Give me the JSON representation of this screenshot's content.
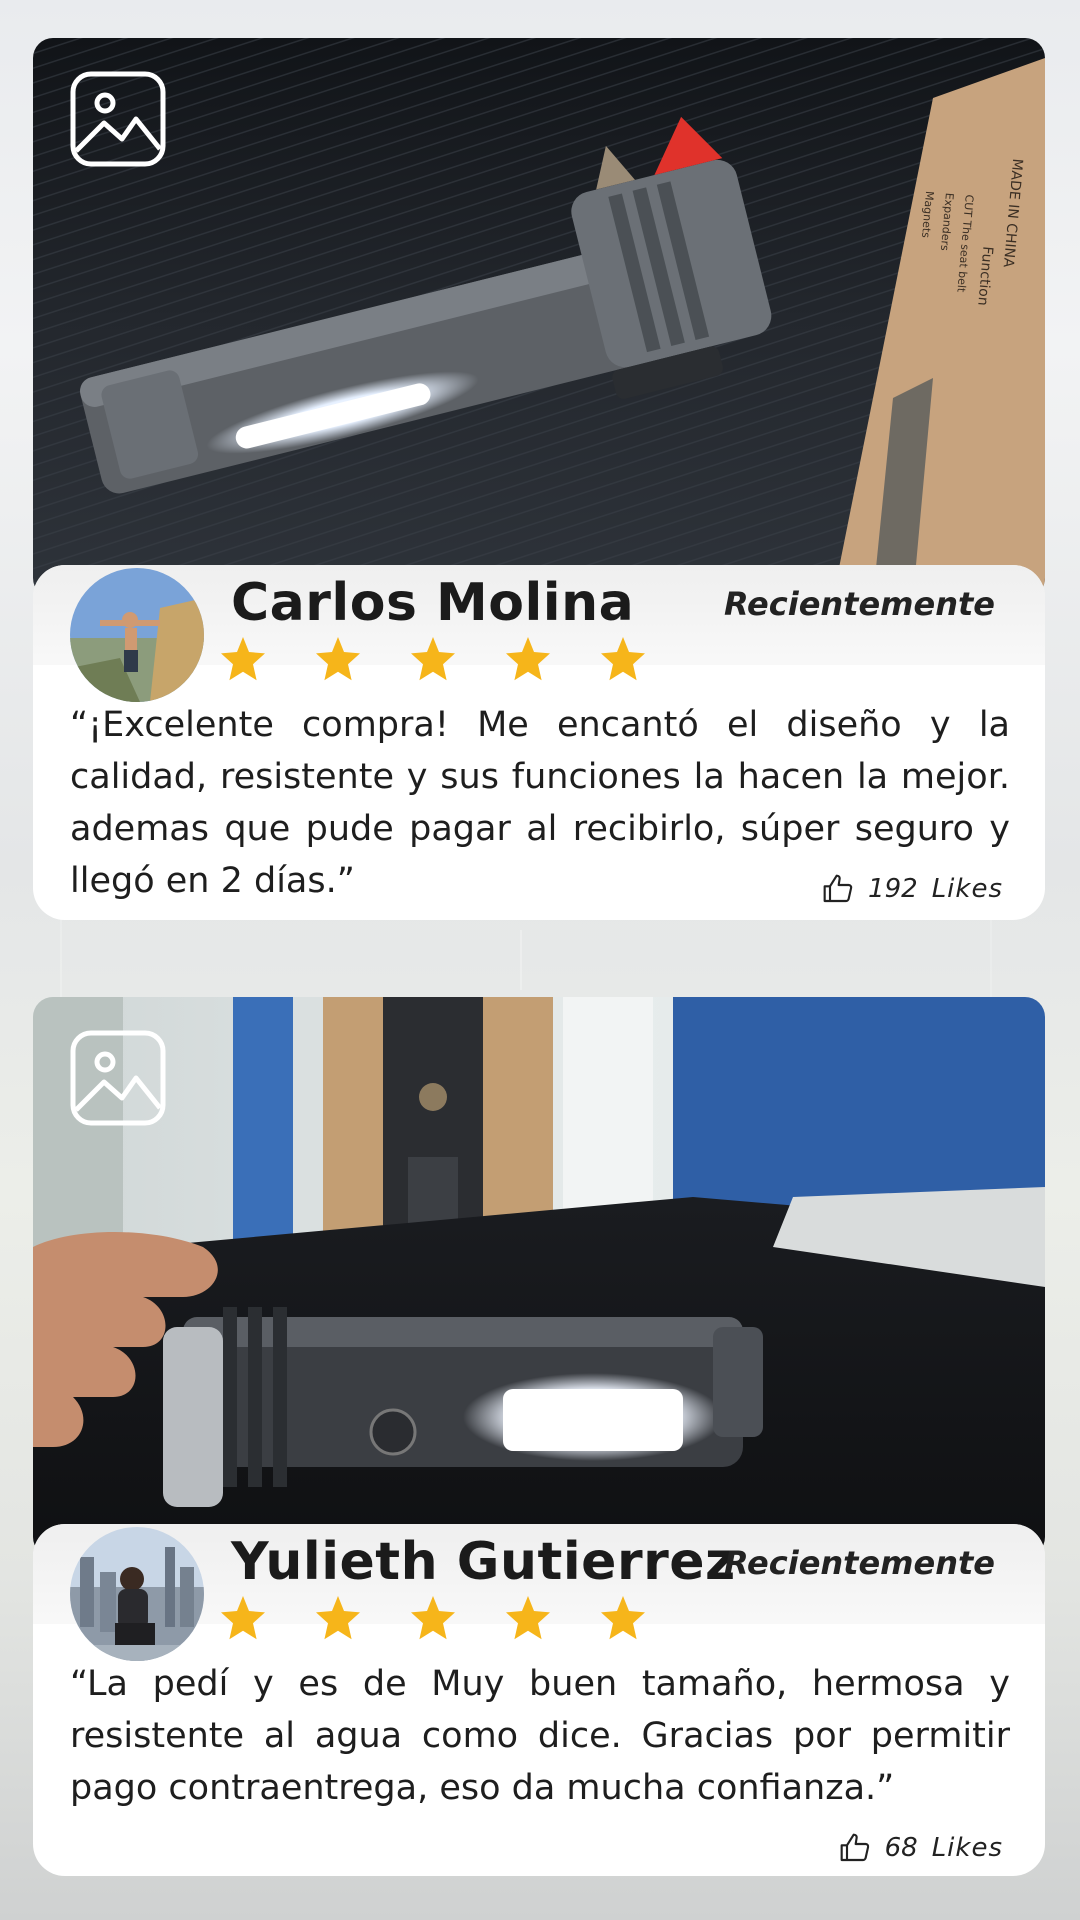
{
  "reviews": [
    {
      "name": "Carlos Molina",
      "date": "Recientemente",
      "rating": 5,
      "text": "“¡Excelente compra! Me encantó el diseño y la calidad, resistente y sus funciones la hacen la mejor. ademas que pude pagar al recibirlo, súper seguro y llegó en 2 días.”",
      "likes_count": "192",
      "likes_label": "Likes",
      "box_text": [
        "MADE IN CHINA",
        "Function",
        "CUT The seat belt",
        "Expanders",
        "Magnets"
      ]
    },
    {
      "name": "Yulieth Gutierrez",
      "date": "Recientemente",
      "rating": 5,
      "text": "“La pedí y es de Muy buen tamaño, hermosa y resistente al agua como dice. Gracias por permitir pago contraentrega, eso da mucha confianza.”",
      "likes_count": "68",
      "likes_label": "Likes"
    }
  ],
  "colors": {
    "star": "#f6b51a",
    "card": "#ffffff",
    "text": "#1e1e1e"
  },
  "icons": {
    "photo_badge": "image-icon",
    "like": "thumbs-up-icon",
    "rating": "star-icon"
  }
}
